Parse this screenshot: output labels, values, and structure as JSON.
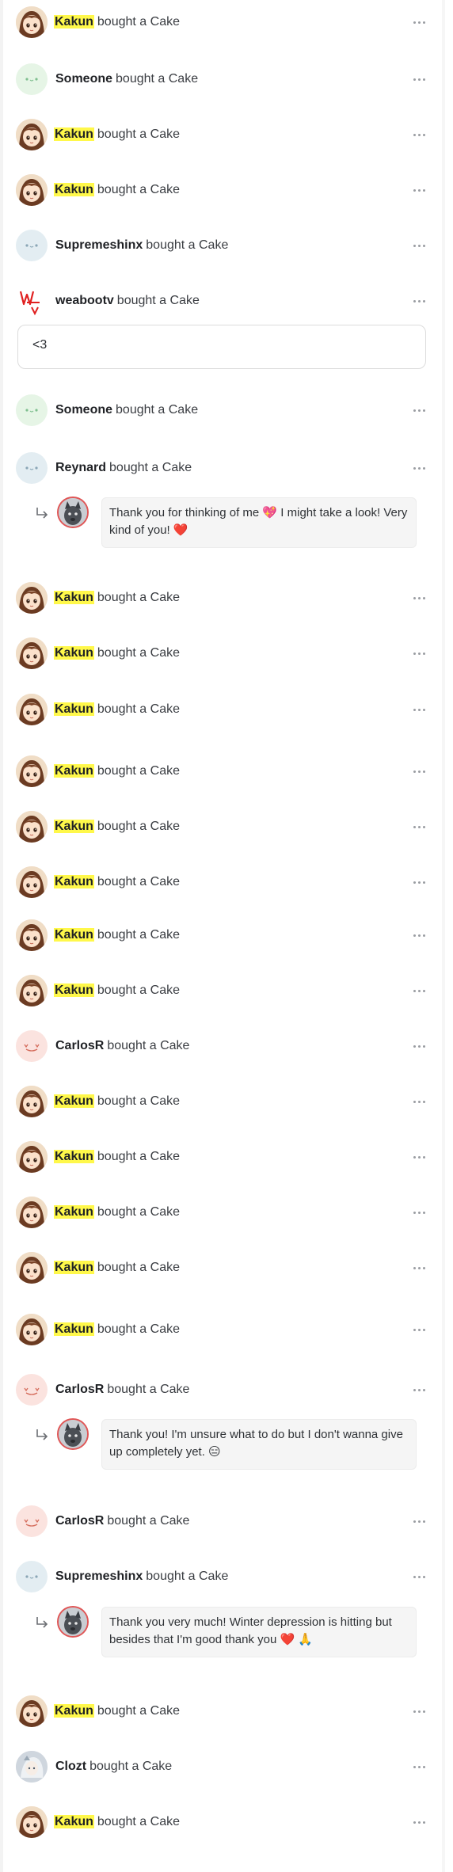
{
  "feed": {
    "action_text": "bought a Cake",
    "items": [
      {
        "name": "Kakun",
        "highlight": true,
        "avatar": "kakun"
      },
      {
        "name": "Someone",
        "highlight": false,
        "avatar": "default-green"
      },
      {
        "name": "Kakun",
        "highlight": true,
        "avatar": "kakun"
      },
      {
        "name": "Kakun",
        "highlight": true,
        "avatar": "kakun"
      },
      {
        "name": "Supremeshinx",
        "highlight": false,
        "avatar": "default-blue"
      },
      {
        "name": "weabootv",
        "highlight": false,
        "avatar": "weaboo-logo"
      },
      {
        "name": "Someone",
        "highlight": false,
        "avatar": "default-green"
      },
      {
        "name": "Reynard",
        "highlight": false,
        "avatar": "default-blue"
      },
      {
        "name": "Kakun",
        "highlight": true,
        "avatar": "kakun"
      },
      {
        "name": "Kakun",
        "highlight": true,
        "avatar": "kakun"
      },
      {
        "name": "Kakun",
        "highlight": true,
        "avatar": "kakun"
      },
      {
        "name": "Kakun",
        "highlight": true,
        "avatar": "kakun"
      },
      {
        "name": "Kakun",
        "highlight": true,
        "avatar": "kakun"
      },
      {
        "name": "Kakun",
        "highlight": true,
        "avatar": "kakun"
      },
      {
        "name": "Kakun",
        "highlight": true,
        "avatar": "kakun"
      },
      {
        "name": "Kakun",
        "highlight": true,
        "avatar": "kakun"
      },
      {
        "name": "CarlosR",
        "highlight": false,
        "avatar": "default-pink"
      },
      {
        "name": "Kakun",
        "highlight": true,
        "avatar": "kakun"
      },
      {
        "name": "Kakun",
        "highlight": true,
        "avatar": "kakun"
      },
      {
        "name": "Kakun",
        "highlight": true,
        "avatar": "kakun"
      },
      {
        "name": "Kakun",
        "highlight": true,
        "avatar": "kakun"
      },
      {
        "name": "Kakun",
        "highlight": true,
        "avatar": "kakun"
      },
      {
        "name": "CarlosR",
        "highlight": false,
        "avatar": "default-pink"
      },
      {
        "name": "CarlosR",
        "highlight": false,
        "avatar": "default-pink"
      },
      {
        "name": "Supremeshinx",
        "highlight": false,
        "avatar": "default-blue"
      },
      {
        "name": "Kakun",
        "highlight": true,
        "avatar": "kakun"
      },
      {
        "name": "Clozt",
        "highlight": false,
        "avatar": "clozt"
      },
      {
        "name": "Kakun",
        "highlight": true,
        "avatar": "kakun"
      }
    ],
    "supporter_message": "<3",
    "creator_replies": [
      {
        "text": "Thank you for thinking of me 💖 I might take a look! Very kind of you! ❤️"
      },
      {
        "text": "Thank you! I'm unsure what to do but I don't wanna give up completely yet. 😑"
      },
      {
        "text": "Thank you very much! Winter depression is hitting but besides that I'm good thank you ❤️ 🙏"
      }
    ],
    "more_icon": "more-horizontal-icon",
    "reply_icon": "reply-arrow-icon",
    "colors": {
      "highlight": "#fff84a",
      "reply_avatar_ring": "#e05656",
      "bubble_bg": "#f5f5f5"
    }
  }
}
